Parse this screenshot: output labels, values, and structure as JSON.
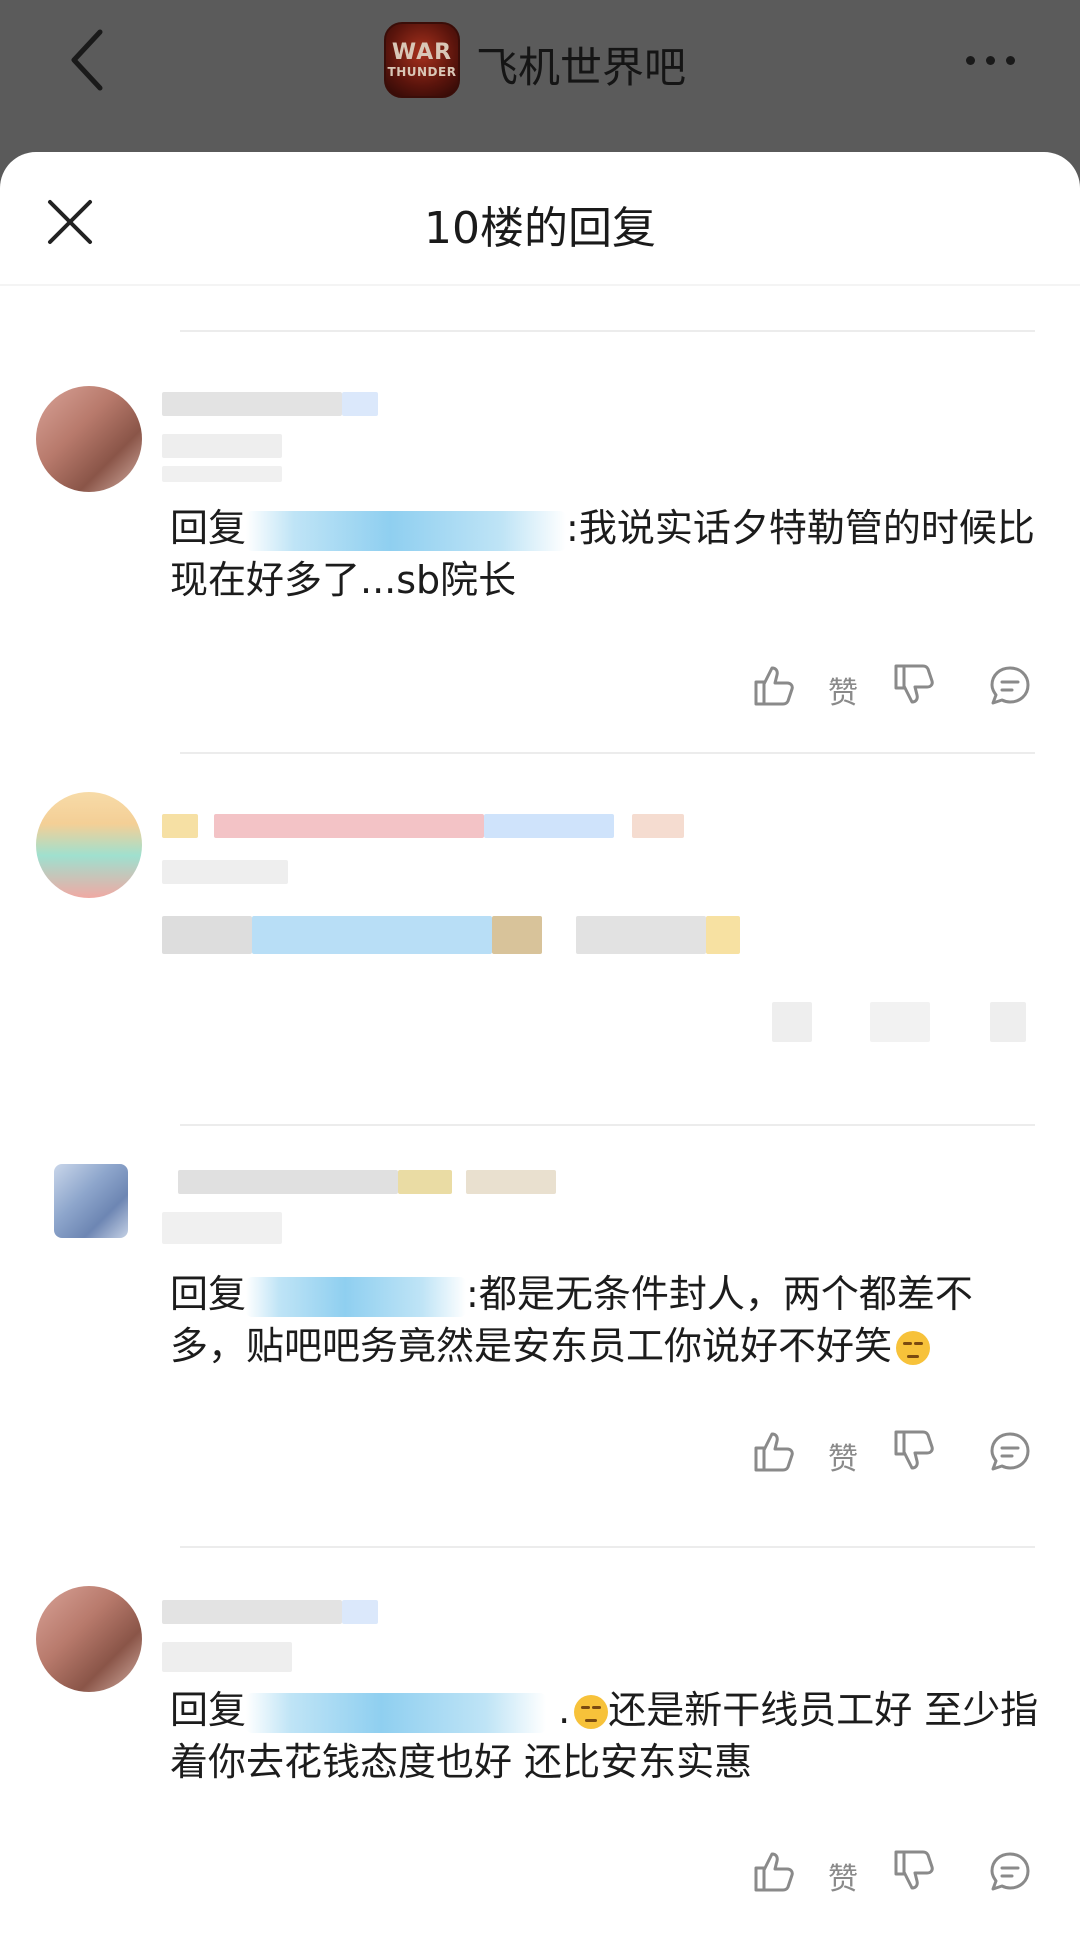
{
  "topbar": {
    "forum_name": "飞机世界吧",
    "logo_text_1": "WAR",
    "logo_text_2": "THUNDER"
  },
  "sheet": {
    "title": "10楼的回复"
  },
  "replies": [
    {
      "prefix": "回复",
      "text": ":我说实话夕特勒管的时候比现在好多了...sb院长",
      "like_label": "赞"
    },
    {
      "prefix": "",
      "text": "",
      "like_label": ""
    },
    {
      "prefix": "回复",
      "text": ":都是无条件封人，两个都差不多，贴吧吧务竟然是安东员工你说好不好笑",
      "like_label": "赞"
    },
    {
      "prefix": "回复",
      "text": "还是新干线员工好 至少指着你去花钱态度也好 还比安东实惠",
      "like_label": "赞"
    }
  ],
  "icons": {
    "back": "chevron-left-icon",
    "more": "more-dots-icon",
    "close": "close-icon",
    "like": "thumbs-up-icon",
    "dislike": "thumbs-down-icon",
    "comment": "comment-bubble-icon"
  },
  "colors": {
    "sheet_bg": "#ffffff",
    "backdrop": "#5a5a5a",
    "action_gray": "#8a8a8a"
  }
}
